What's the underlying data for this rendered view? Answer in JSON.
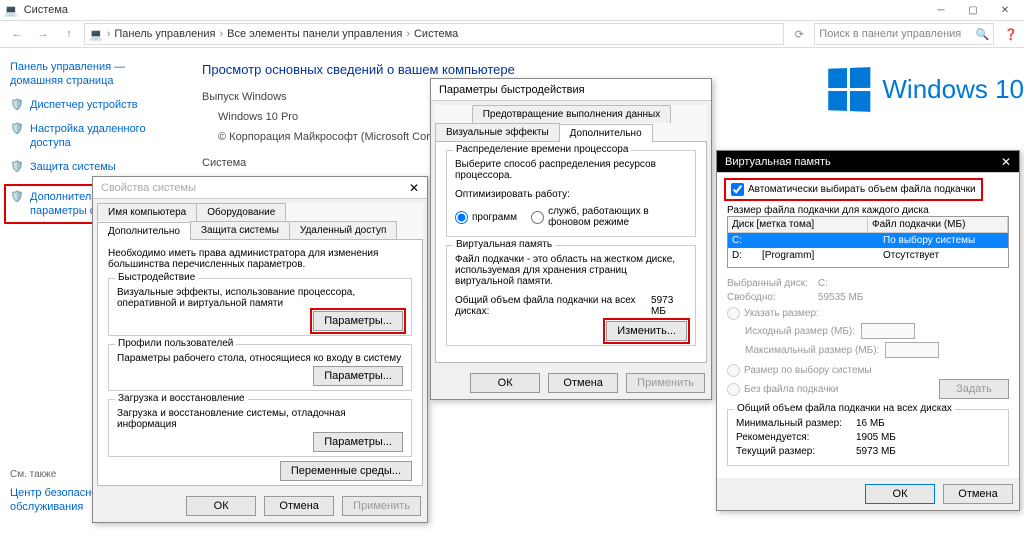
{
  "window": {
    "title": "Система",
    "breadcrumbs": [
      "Панель управления",
      "Все элементы панели управления",
      "Система"
    ],
    "search_placeholder": "Поиск в панели управления"
  },
  "leftnav": {
    "home": "Панель управления — домашняя страница",
    "links": [
      {
        "label": "Диспетчер устройств"
      },
      {
        "label": "Настройка удаленного доступа"
      },
      {
        "label": "Защита системы"
      },
      {
        "label": "Дополнительные параметры системы",
        "hl": true
      }
    ],
    "also_title": "См. также",
    "also": "Центр безопасности и обслуживания"
  },
  "main": {
    "heading": "Просмотр основных сведений о вашем компьютере",
    "ed_label": "Выпуск Windows",
    "edition": "Windows 10 Pro",
    "copyright": "© Корпорация Майкрософт (Microsoft Corporation).",
    "sys_label": "Система",
    "brand": "Windows 10"
  },
  "sysprops": {
    "title": "Свойства системы",
    "tabs": [
      "Имя компьютера",
      "Оборудование",
      "Дополнительно",
      "Защита системы",
      "Удаленный доступ"
    ],
    "note": "Необходимо иметь права администратора для изменения большинства перечисленных параметров.",
    "perf": {
      "legend": "Быстродействие",
      "desc": "Визуальные эффекты, использование процессора, оперативной и виртуальной памяти",
      "btn": "Параметры..."
    },
    "profiles": {
      "legend": "Профили пользователей",
      "desc": "Параметры рабочего стола, относящиеся ко входу в систему",
      "btn": "Параметры..."
    },
    "startup": {
      "legend": "Загрузка и восстановление",
      "desc": "Загрузка и восстановление системы, отладочная информация",
      "btn": "Параметры..."
    },
    "envbtn": "Переменные среды...",
    "ok": "ОК",
    "cancel": "Отмена",
    "apply": "Применить"
  },
  "perfopts": {
    "title": "Параметры быстродействия",
    "tabs": [
      "Визуальные эффекты",
      "Дополнительно",
      "Предотвращение выполнения данных"
    ],
    "cpu": {
      "legend": "Распределение времени процессора",
      "desc": "Выберите способ распределения ресурсов процессора.",
      "opt_label": "Оптимизировать работу:",
      "r1": "программ",
      "r2": "служб, работающих в фоновом режиме"
    },
    "vm": {
      "legend": "Виртуальная память",
      "desc": "Файл подкачки - это область на жестком диске, используемая для хранения страниц виртуальной памяти.",
      "total_label": "Общий объем файла подкачки на всех дисках:",
      "total_val": "5973 МБ",
      "btn": "Изменить..."
    },
    "ok": "ОК",
    "cancel": "Отмена",
    "apply": "Применить"
  },
  "vmem": {
    "title": "Виртуальная память",
    "auto": "Автоматически выбирать объем файла подкачки",
    "pervol": "Размер файла подкачки для каждого диска",
    "hdr1": "Диск [метка тома]",
    "hdr2": "Файл подкачки (МБ)",
    "rows": [
      {
        "d": "C:",
        "l": "",
        "v": "По выбору системы",
        "sel": true
      },
      {
        "d": "D:",
        "l": "[Programm]",
        "v": "Отсутствует"
      }
    ],
    "sel_label": "Выбранный диск:",
    "sel_val": "C:",
    "free_label": "Свободно:",
    "free_val": "59535 МБ",
    "custom": "Указать размер:",
    "init": "Исходный размер (МБ):",
    "max": "Максимальный размер (МБ):",
    "sys": "Размер по выбору системы",
    "none": "Без файла подкачки",
    "setbtn": "Задать",
    "total_lbl": "Общий объем файла подкачки на всех дисках",
    "min_l": "Минимальный размер:",
    "min_v": "16 МБ",
    "rec_l": "Рекомендуется:",
    "rec_v": "1905 МБ",
    "cur_l": "Текущий размер:",
    "cur_v": "5973 МБ",
    "ok": "ОК",
    "cancel": "Отмена"
  }
}
